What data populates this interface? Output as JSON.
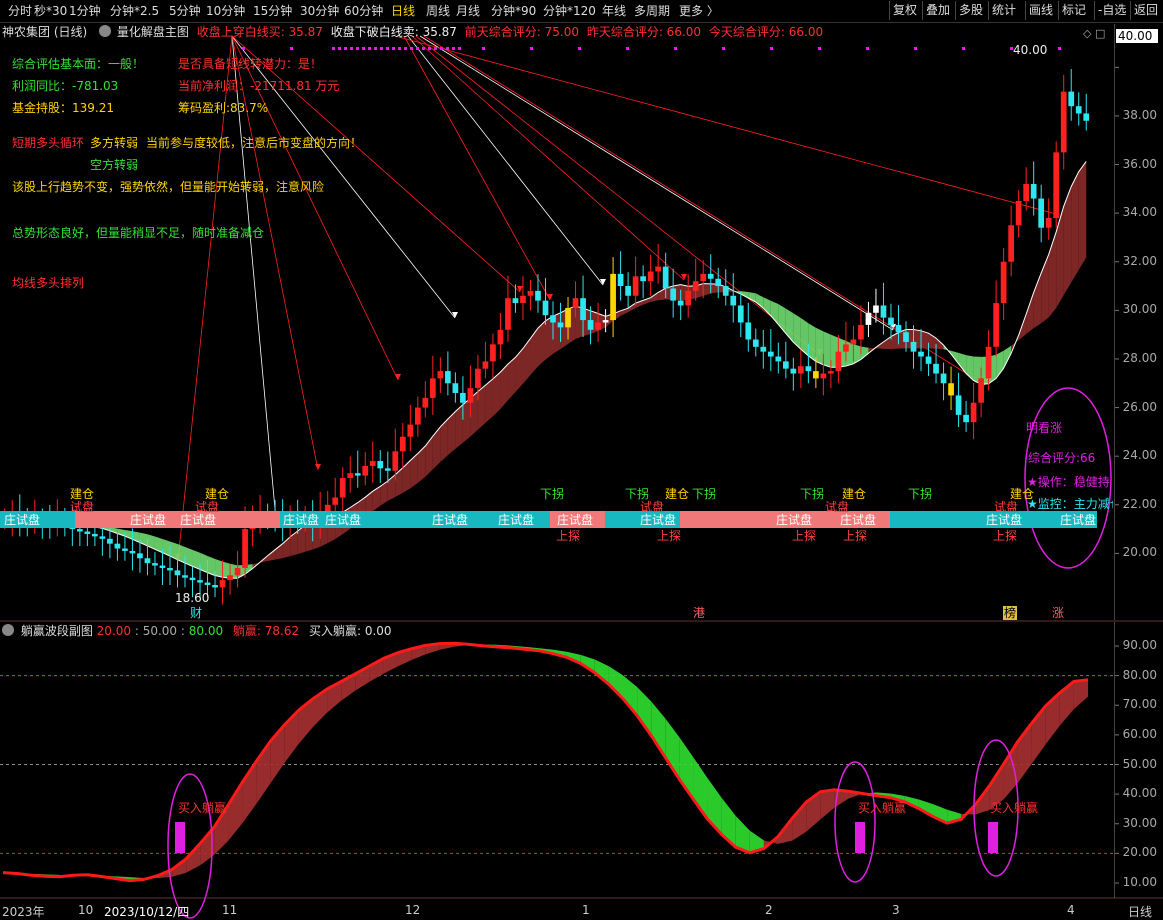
{
  "toolbar": {
    "periods": [
      "分时",
      "秒*30",
      "1分钟",
      "分钟*2.5",
      "5分钟",
      "10分钟",
      "15分钟",
      "30分钟",
      "60分钟",
      "日线",
      "周线",
      "月线",
      "分钟*90",
      "分钟*120",
      "年线",
      "多周期",
      "更多 〉"
    ],
    "selected": "日线",
    "right": [
      "复权",
      "叠加",
      "多股",
      "统计",
      "画线",
      "标记",
      "-自选",
      "返回"
    ]
  },
  "header": {
    "stock": "神农集团 (日线)",
    "indicator": "量化解盘主图",
    "buy_line": "收盘上穿白线买: 35.87",
    "sell_line": "收盘下破白线卖: 35.87",
    "prev_score": "前天综合评分: 75.00",
    "yest_score": "昨天综合评分: 66.00",
    "today_score": "今天综合评分: 66.00",
    "price_tag": "40.00"
  },
  "notes": {
    "fundamental": "综合评估基本面：一般！",
    "profit_yoy": "利润同比：-781.03",
    "fund_hold": "基金持股：139.21",
    "reverse": "是否具备短线转潜力：是！",
    "net_profit": "当前净利润：-21711.81  万元",
    "chip_profit": "筹码盈利:83.7%",
    "cycle_label": "短期多头循环",
    "cycle_1": "多方转弱",
    "cycle_2": "当前参与度较低，注意后市变盘的方向！",
    "cycle_3": "空方转弱",
    "trend": "该股上行趋势不变，强势依然，但量能开始转弱，注意风险",
    "pattern": "总势形态良好，但量能稍显不足，随时准备减仓",
    "ma": "均线多头排列",
    "bull": "明看涨",
    "score": "综合评分:66",
    "op": "★操作：稳健持股",
    "monitor": "★监控：主力减仓"
  },
  "band_labels": {
    "zhuang": "庄试盘",
    "shipan": "试盘",
    "jiancang": "建仓",
    "xiawa": "下拐",
    "shangtan": "上探",
    "low": "18.60",
    "high": "40.00",
    "cai": "财",
    "gang": "港",
    "bang": "榜",
    "zhang": "涨"
  },
  "colors": {
    "up": "#ff2020",
    "down": "#2ee6f0",
    "white": "#ffffff",
    "yellow": "#ffd400",
    "ribbon_red": "#8b2a2a",
    "ribbon_green": "#6fdc6f",
    "band_cyan": "#18b8c0",
    "band_pink": "#f07878"
  },
  "sub": {
    "title": "躺赢波段副图",
    "p20": "20.00",
    "p50": "50.00",
    "p80": "80.00",
    "value": "躺赢: 78.62",
    "buy": "买入躺赢: 0.00",
    "buy_marker": "买入躺赢"
  },
  "xaxis": [
    "2023年",
    "10",
    "2023/10/12/四",
    "11",
    "12",
    "1",
    "2",
    "3",
    "4",
    "日线"
  ],
  "chart_data": [
    {
      "type": "candlestick",
      "title": "量化解盘主图",
      "ylim": [
        18,
        41
      ],
      "yticks": [
        20,
        22,
        24,
        26,
        28,
        30,
        32,
        34,
        36,
        38,
        40
      ],
      "high_mark": 40.0,
      "low_mark": 18.6,
      "close": [
        21.4,
        21.5,
        21.3,
        21.2,
        21.4,
        21.3,
        21.2,
        21.3,
        21.1,
        21.0,
        20.9,
        20.8,
        20.7,
        20.6,
        20.4,
        20.2,
        20.1,
        20.0,
        19.8,
        19.6,
        19.5,
        19.4,
        19.3,
        19.1,
        19.0,
        18.9,
        18.8,
        18.7,
        18.6,
        18.9,
        19.1,
        19.4,
        21.0,
        21.4,
        21.6,
        21.5,
        21.3,
        21.2,
        21.4,
        21.3,
        21.5,
        21.2,
        21.6,
        22.0,
        22.3,
        23.1,
        23.3,
        23.2,
        23.6,
        23.8,
        23.5,
        23.4,
        24.2,
        24.8,
        25.3,
        26.0,
        26.4,
        27.2,
        27.5,
        27.0,
        26.6,
        26.2,
        26.8,
        27.6,
        27.9,
        28.6,
        29.2,
        30.5,
        30.3,
        30.6,
        30.8,
        30.4,
        29.8,
        29.5,
        29.3,
        30.1,
        30.5,
        29.6,
        29.2,
        29.5,
        29.6,
        31.5,
        31.0,
        30.6,
        31.4,
        31.2,
        31.6,
        31.8,
        30.9,
        30.4,
        30.2,
        30.8,
        31.2,
        31.5,
        31.3,
        31.0,
        30.6,
        30.2,
        29.5,
        28.8,
        28.5,
        28.3,
        28.1,
        27.9,
        27.6,
        27.4,
        27.7,
        27.5,
        27.2,
        27.4,
        27.5,
        28.3,
        28.6,
        28.8,
        29.4,
        29.9,
        30.2,
        29.7,
        29.4,
        29.1,
        28.7,
        28.3,
        28.1,
        27.8,
        27.4,
        27.0,
        26.5,
        25.7,
        25.4,
        26.2,
        27.2,
        28.5,
        30.3,
        32.0,
        33.5,
        34.5,
        35.2,
        34.6,
        33.4,
        33.8,
        36.5,
        39.0,
        38.4,
        38.1,
        37.8
      ]
    },
    {
      "type": "line",
      "title": "躺赢波段副图",
      "ylim": [
        5,
        95
      ],
      "yticks": [
        10,
        20,
        30,
        40,
        50,
        60,
        70,
        80,
        90
      ],
      "levels": [
        20,
        50,
        80
      ],
      "value_last": 78.62,
      "buy_last": 0.0,
      "values": [
        13.5,
        13.2,
        12.6,
        12.3,
        12.1,
        12.6,
        12.8,
        12.2,
        11.5,
        10.8,
        11.2,
        12.5,
        14.6,
        18.2,
        23.4,
        29.0,
        36.5,
        44.1,
        51.2,
        58.0,
        63.5,
        68.4,
        72.2,
        75.5,
        78.0,
        80.6,
        83.2,
        85.8,
        87.7,
        89.1,
        90.2,
        90.8,
        90.9,
        90.6,
        90.1,
        89.7,
        89.4,
        88.9,
        88.4,
        87.5,
        86.2,
        84.1,
        81.0,
        77.0,
        72.2,
        66.5,
        59.8,
        52.4,
        45.0,
        38.2,
        31.6,
        26.4,
        22.1,
        20.2,
        21.6,
        25.7,
        31.8,
        37.3,
        40.8,
        41.5,
        41.0,
        40.2,
        39.5,
        38.8,
        37.4,
        35.1,
        32.4,
        30.2,
        31.5,
        36.4,
        42.8,
        50.1,
        57.6,
        63.9,
        69.8,
        74.2,
        78.0,
        78.6
      ]
    }
  ]
}
